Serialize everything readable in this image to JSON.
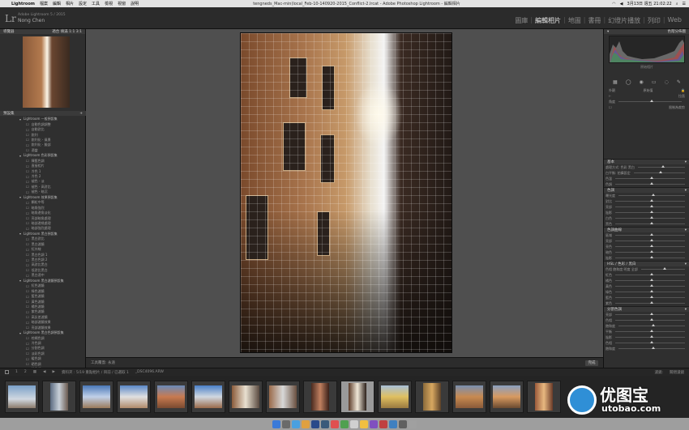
{
  "menubar": {
    "app_name": "Lightroom",
    "menus": [
      "檔案",
      "編輯",
      "相片",
      "設定",
      "工具",
      "檢視",
      "視窗",
      "說明"
    ],
    "window_title": "tengneds_Mac-min(local_Feb-10-140920-2015_Conflict-2.lrcat - Adobe Photoshop Lightroom - 編輯相片",
    "clock": "3月13日 週五 21:02:22"
  },
  "identity": {
    "logo": "Lr",
    "product": "Adobe Lightroom 5 / 2015",
    "user": "Nong Chen"
  },
  "modules": {
    "items": [
      "圖庫",
      "編輯相片",
      "地圖",
      "書冊",
      "幻燈片播放",
      "列印",
      "Web"
    ],
    "active": "編輯相片"
  },
  "left_panel": {
    "navigator_title": "導覽器",
    "navigator_options": "適合  填滿  1:1  3:1",
    "presets_title": "預設集",
    "presets": [
      {
        "t": "f",
        "label": "Lightroom 一般預設集"
      },
      {
        "t": "p",
        "label": "自動色調調整"
      },
      {
        "t": "p",
        "label": "自動對比"
      },
      {
        "t": "p",
        "label": "銳利"
      },
      {
        "t": "p",
        "label": "銳利化 - 風景"
      },
      {
        "t": "p",
        "label": "銳利化 - 臉部"
      },
      {
        "t": "p",
        "label": "適當"
      },
      {
        "t": "f",
        "label": "Lightroom 色彩預設集"
      },
      {
        "t": "p",
        "label": "陳舊色調"
      },
      {
        "t": "p",
        "label": "直接相片"
      },
      {
        "t": "p",
        "label": "冷色 1"
      },
      {
        "t": "p",
        "label": "冷色 2"
      },
      {
        "t": "p",
        "label": "褪色 - 淡"
      },
      {
        "t": "p",
        "label": "褪色 - 高對比"
      },
      {
        "t": "p",
        "label": "褪色 - 暗沉"
      },
      {
        "t": "f",
        "label": "Lightroom 效果預設集"
      },
      {
        "t": "p",
        "label": "顆粒中等"
      },
      {
        "t": "p",
        "label": "暗角強烈"
      },
      {
        "t": "p",
        "label": "暗角邊角淡化"
      },
      {
        "t": "p",
        "label": "亮部暗角處理"
      },
      {
        "t": "p",
        "label": "暗部邊緣處理"
      },
      {
        "t": "p",
        "label": "暗部強烈處理"
      },
      {
        "t": "f",
        "label": "Lightroom 黑白預設集"
      },
      {
        "t": "p",
        "label": "黑白對比"
      },
      {
        "t": "p",
        "label": "黑白濾鏡"
      },
      {
        "t": "p",
        "label": "紅外線"
      },
      {
        "t": "p",
        "label": "黑白色調 1"
      },
      {
        "t": "p",
        "label": "黑白色調 2"
      },
      {
        "t": "p",
        "label": "高對比黑白"
      },
      {
        "t": "p",
        "label": "低對比黑白"
      },
      {
        "t": "p",
        "label": "黑白適中"
      },
      {
        "t": "f",
        "label": "Lightroom 黑白濾鏡預設集"
      },
      {
        "t": "p",
        "label": "紅色濾鏡"
      },
      {
        "t": "p",
        "label": "綠色濾鏡"
      },
      {
        "t": "p",
        "label": "藍色濾鏡"
      },
      {
        "t": "p",
        "label": "黃色濾鏡"
      },
      {
        "t": "p",
        "label": "橘色濾鏡"
      },
      {
        "t": "p",
        "label": "紫色濾鏡"
      },
      {
        "t": "p",
        "label": "高反差濾鏡"
      },
      {
        "t": "p",
        "label": "暗部濾鏡效果"
      },
      {
        "t": "p",
        "label": "亮部濾鏡效果"
      },
      {
        "t": "f",
        "label": "Lightroom 黑白色調預設集"
      },
      {
        "t": "p",
        "label": "棕褐色調"
      },
      {
        "t": "p",
        "label": "冷色調"
      },
      {
        "t": "p",
        "label": "分割色調"
      },
      {
        "t": "p",
        "label": "淡彩色調"
      },
      {
        "t": "p",
        "label": "暖色調"
      },
      {
        "t": "p",
        "label": "硒色調"
      },
      {
        "t": "p",
        "label": "雙色調"
      }
    ],
    "copy_button": "拷貝...",
    "paste_button": "貼上"
  },
  "center": {
    "tool_overlay_label": "工具覆蓋:",
    "tool_overlay_value": "永遠",
    "done_button": "完成"
  },
  "right_panel": {
    "histogram_title": "色階分佈圖",
    "histogram_info": "原始相片",
    "crop": {
      "angle_label": "角度",
      "lock_label": "外觀",
      "aspect_label": "原始值",
      "constrain_label": "限制為裁剪",
      "straighten_label": "拉直"
    },
    "sections": [
      {
        "title": "基本",
        "rows": [
          "處理方式: 色彩 黑白",
          "白平衡: 拍攝設定",
          "色溫",
          "色調"
        ]
      },
      {
        "title": "色調",
        "rows": [
          "曝光度",
          "對比",
          "亮部",
          "陰影",
          "白色",
          "黑色"
        ]
      },
      {
        "title": "色調曲線",
        "rows": [
          "區域",
          "亮部",
          "亮色",
          "暗色",
          "陰影"
        ]
      },
      {
        "title": "HSL / 色彩 / 黑白",
        "rows": [
          "色相 飽和度 明度 全部",
          "紅色",
          "橘色",
          "黃色",
          "綠色",
          "藍色",
          "紫色"
        ]
      },
      {
        "title": "分割色調",
        "rows": [
          "亮部",
          "色相",
          "飽和度",
          "平衡",
          "陰影",
          "色相",
          "飽和度"
        ]
      }
    ],
    "prev_button": "上一個",
    "reset_button": "重設 (Adobe)"
  },
  "filmstrip_bar": {
    "page1": "1",
    "page2": "2",
    "source": "資料夾 : 5/19 重點相片 / 目前 / 已選取 1",
    "filename": "_DSC4096.ARW",
    "filter_label": "濾鏡:",
    "filter_value": "關閉濾鏡"
  },
  "watermark": {
    "cn": "优图宝",
    "url": "utobao.com"
  }
}
